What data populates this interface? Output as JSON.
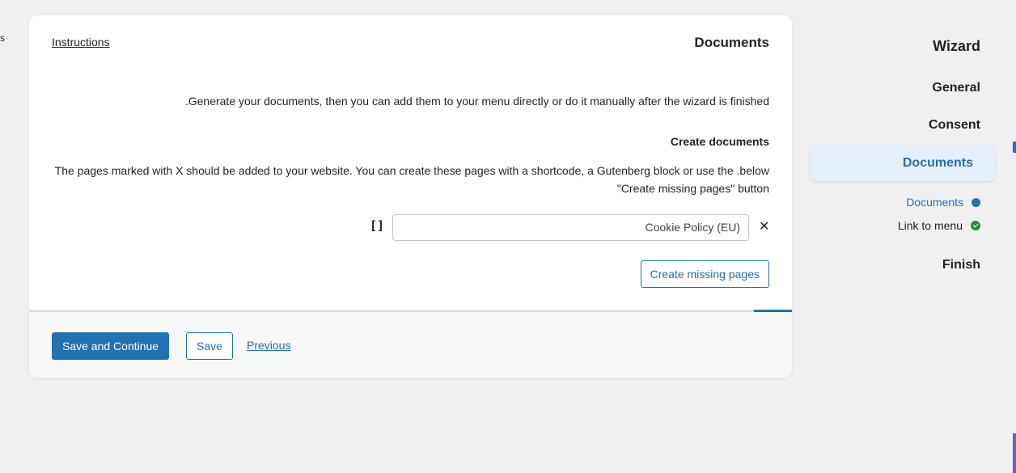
{
  "edge_mark": "s",
  "card": {
    "instructions_link": "Instructions",
    "title": "Documents",
    "intro": ".Generate your documents, then you can add them to your menu directly or do it manually after the wizard is finished",
    "section_title": "Create documents",
    "description": "The pages marked with X should be added to your website. You can create these pages with a shortcode, a Gutenberg block or use the .below \"Create missing pages\" button",
    "document_row": {
      "checkbox_glyph": "[]",
      "value": "Cookie Policy (EU)",
      "remove_glyph": "✕"
    },
    "create_button": "Create missing pages",
    "progress_fraction": 0.05
  },
  "footer": {
    "save_continue": "Save and Continue",
    "save": "Save",
    "previous": "Previous"
  },
  "wizard": {
    "title": "Wizard",
    "steps": {
      "general": "General",
      "consent": "Consent",
      "documents": "Documents",
      "finish": "Finish"
    },
    "substeps": {
      "documents": "Documents",
      "link_to_menu": "Link to menu"
    }
  },
  "colors": {
    "accent": "#2271b1",
    "success": "#2e8a37",
    "active_step_bg": "#e6f0fa"
  }
}
